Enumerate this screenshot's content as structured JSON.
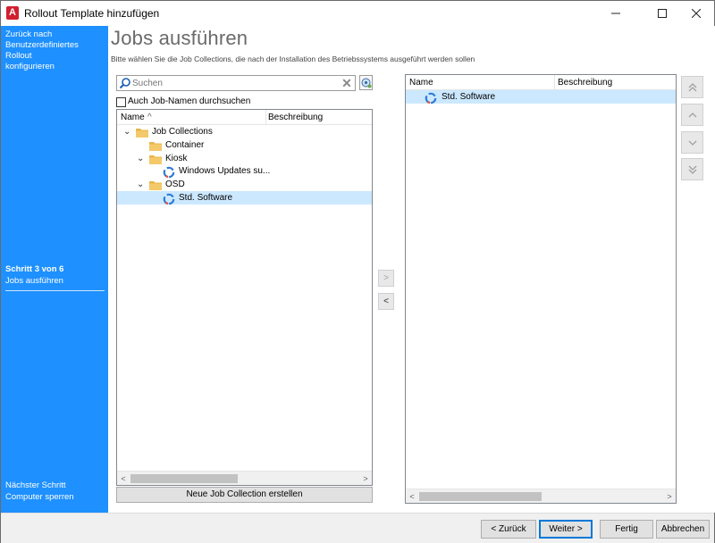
{
  "window": {
    "title": "Rollout Template hinzufügen",
    "app_icon_letter": "A",
    "controls": {
      "minimize": "—",
      "maximize": "☐",
      "close": "✕"
    }
  },
  "sidebar": {
    "back_line1": "Zurück nach",
    "back_line2": "Benutzerdefiniertes Rollout",
    "back_line3": "konfigurieren",
    "step": "Schritt 3 von 6",
    "step_name": "Jobs ausführen",
    "next_label": "Nächster Schritt",
    "next_name": "Computer sperren"
  },
  "main": {
    "title": "Jobs ausführen",
    "subtitle": "Bitte wählen Sie die Job Collections, die nach der Installation des Betriebssystems ausgeführt werden sollen"
  },
  "search": {
    "placeholder": "Suchen",
    "value": "",
    "checkbox_label": "Auch Job-Namen durchsuchen",
    "checkbox_checked": false
  },
  "left_tree": {
    "col_name": "Name",
    "sort_indicator": "^",
    "col_desc": "Beschreibung",
    "rows": [
      {
        "label": "Job Collections",
        "type": "folder",
        "level": 0,
        "expanded": true
      },
      {
        "label": "Container",
        "type": "folder",
        "level": 1,
        "expanded": false
      },
      {
        "label": "Kiosk",
        "type": "folder",
        "level": 1,
        "expanded": true
      },
      {
        "label": "Windows Updates su...",
        "type": "job",
        "level": 2
      },
      {
        "label": "OSD",
        "type": "folder",
        "level": 1,
        "expanded": true
      },
      {
        "label": "Std. Software",
        "type": "job",
        "level": 2,
        "selected": true
      }
    ],
    "scroll_left": "<",
    "scroll_right": ">"
  },
  "new_collection_button": "Neue Job Collection erstellen",
  "transfer": {
    "add": ">",
    "remove": "<"
  },
  "right_list": {
    "col_name": "Name",
    "col_desc": "Beschreibung",
    "rows": [
      {
        "label": "Std. Software",
        "selected": true
      }
    ],
    "scroll_left": "<",
    "scroll_right": ">"
  },
  "order_buttons": {
    "top": "«",
    "up": "‹",
    "down": "›",
    "bottom": "»"
  },
  "footer": {
    "back": "< Zurück",
    "back_mnemonic": "Z",
    "next": "Weiter >",
    "finish": "Fertig",
    "cancel": "Abbrechen"
  },
  "colors": {
    "sidebar": "#1e90ff",
    "selection": "#cce8ff",
    "folder": "#e8b54a",
    "accent": "#0078d7"
  }
}
